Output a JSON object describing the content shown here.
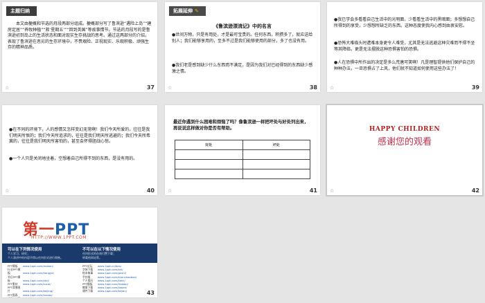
{
  "slides": [
    {
      "number": "37",
      "tag": "主题归纳",
      "paragraph": "本文由梗概和节选的月段两部分组成。梗概部分写了鲁滨逊“遇险上岛”“建房定居”“养牧种植”“救‘星期五’”“回到英国”等故事情节。节选的月段写的是鲁滨逊初到岛上的生活状态和面对现实生存挑战的思考。通过这两部分的介绍，表现了鲁滨逊在恶劣的生存环境中，不畏艰险、正视现实、乐观积极、顽强生存的精神品质。"
    },
    {
      "number": "38",
      "tag": "拓展延伸",
      "title": "《鲁滨逊漂流记》中的名言",
      "lines": [
        "●世间万物，只是有用处，才是最可宝贵的。任何东西，积攒多了，就应送给别人；我们能够享用的，至多不过是我们能够使用的部分，多了也没有用。",
        "●我们老是感到缺少什么东西而不满足，是因为我们对已经得到的东西缺少感激之情。"
      ]
    },
    {
      "number": "39",
      "lines": [
        "●我已学会多看看自己生活中的光明面，少看看生活中的黑暗面；多想想自己所得到的享受，少想想所缺乏的东西。这种态度使我内心感到由衷安慰。",
        "●恐怖大难临头时遭难本身更令人难受，尤其是无法逃避这种灾难而不得不坐等其降临，更是无法摆脱这种恐惧害怕的恐惧。",
        "●人在恐惧中所作出的决定是多么荒唐可笑啊！凡是理智提供他们保护自己的种种办法，一旦恐惧占了上风，他们就不知道如何使用这些办法了！"
      ]
    },
    {
      "number": "40",
      "lines": [
        "●在不同的环境下，人的感情又怎样变幻无常啊！我们今天所爱的，往往是我们明天所恨的；我们今天所追求的，往往是我们明天所逃避的；我们今天所希冀的，往往是我们明天所害怕的，甚至会怀得胆战心惊。",
        "●一个人只是关闭地坐着，空想着自己所得不到的东西，是没有用的。"
      ]
    },
    {
      "number": "41",
      "question": "最近你遇到什么困难和烦恼了吗？像鲁滨逊一样把坏处与好处列出来，再说说这样做对你是否有帮助。",
      "table_headers": [
        "好处",
        "坏处"
      ]
    },
    {
      "number": "42",
      "happy": "HAPPY CHILDREN",
      "thanks": "感谢您的观看"
    },
    {
      "number": "43",
      "logo_part1": "第一",
      "logo_part2": "PPT",
      "url": "HTTP://WWW.1PPT.COM",
      "left_title": "可以在下列情况使用",
      "left_sub": [
        "个人学习、研究；",
        "个人演讲中的内容不得以任何形式进行销售。"
      ],
      "right_title": "不可以在以下情况使用",
      "right_sub": [
        "任何形式的在线付费下载；",
        "转载他网站等。"
      ],
      "left_links": [
        [
          "PPT模板",
          "www.1ppt.com/moban/"
        ],
        [
          "行业PPT模板",
          "www.1ppt.com/hangye/"
        ],
        [
          "节日PPT模板",
          "www.1ppt.com/jieri/"
        ],
        [
          "PPT素材",
          "www.1ppt.com/sucai/"
        ],
        [
          "PPT背景图片",
          "www.1ppt.com/beijing/"
        ],
        [
          "PPT图表",
          "www.1ppt.com/tubiao/"
        ],
        [
          "优秀PPT下载",
          "www.1ppt.com/xiazai/"
        ],
        [
          "PPT教程",
          "www.1ppt.com/powerpoint/"
        ],
        [
          "Word教程",
          "www.1ppt.com/word/"
        ],
        [
          "Excel教程",
          "www.1ppt.com/excel/"
        ],
        [
          "资料下载",
          "www.1ppt.com/ziliao/"
        ],
        [
          "PPT课件",
          "www.1ppt.com/kejian/"
        ],
        [
          "范文下载",
          "www.1ppt.com/fanwen/"
        ],
        [
          "试卷下载",
          "www.1ppt.com/shiti/"
        ],
        [
          "教案下载",
          "www.1ppt.com/jiaoan/"
        ]
      ],
      "right_links": [
        [
          "PPT论坛",
          "www.1ppt.cn/bbs/"
        ],
        [
          "字体下载",
          "www.1ppt.com/ziti/"
        ],
        [
          "绘本故事",
          "www.1ppt.com/gushi/"
        ],
        [
          "手抄报",
          "www.1ppt.com/shouchaobao/"
        ],
        [
          "个人简历",
          "www.1ppt.com/jianli/"
        ],
        [
          "PPT模板",
          "www.1ppt.com/moban/"
        ],
        [
          "教案下载",
          "www.1ppt.com/jiaoan/"
        ],
        [
          "课件下载",
          "www.1ppt.com/kejian/"
        ],
        [
          "试卷下载",
          "www.1ppt.com/shiti/"
        ]
      ]
    }
  ],
  "star_glyph": "☆"
}
